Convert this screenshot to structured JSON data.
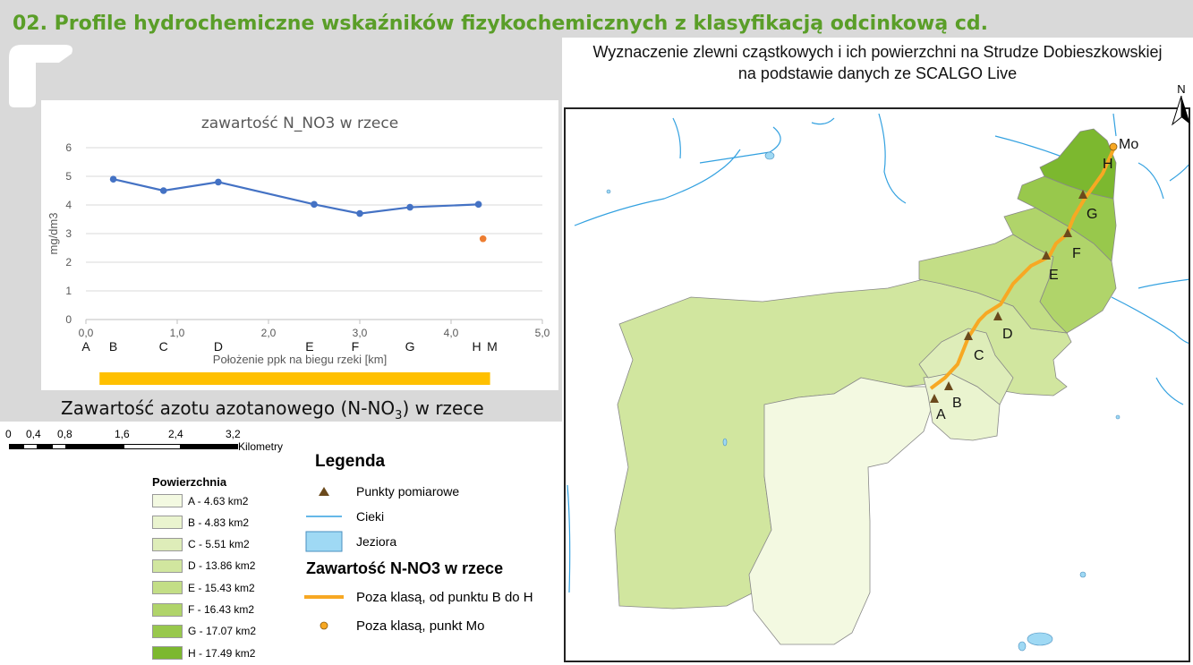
{
  "slide_title": "02.  Profile hydrochemiczne wskaźników fizykochemicznych z klasyfikacją odcinkową cd.",
  "chart_caption": {
    "main": "Zawartość azotu azotanowego (N-NO",
    "sub": "3",
    "tail": ") w rzece"
  },
  "chart_data": {
    "type": "scatter",
    "title": "zawartość N_NO3 w rzece",
    "xlabel": "Położenie ppk na biegu rzeki [km]",
    "ylabel": "mg/dm3",
    "xlim": [
      0,
      5
    ],
    "ylim": [
      0,
      6
    ],
    "x_ticks": [
      "0,0",
      "1,0",
      "2,0",
      "3,0",
      "4,0",
      "5,0"
    ],
    "y_ticks": [
      "0",
      "1",
      "2",
      "3",
      "4",
      "5",
      "6"
    ],
    "grid": true,
    "series": [
      {
        "color": "#4472c4",
        "mode": "line+markers",
        "points": [
          [
            0.3,
            4.9
          ],
          [
            0.85,
            4.5
          ],
          [
            1.45,
            4.8
          ],
          [
            2.5,
            4.02
          ],
          [
            3.0,
            3.7
          ],
          [
            3.55,
            3.92
          ],
          [
            4.3,
            4.02
          ]
        ]
      },
      {
        "color": "#ed7d31",
        "mode": "markers",
        "points": [
          [
            4.35,
            2.82
          ]
        ]
      }
    ],
    "point_labels": [
      {
        "label": "A",
        "x": 0.0
      },
      {
        "label": "B",
        "x": 0.3
      },
      {
        "label": "C",
        "x": 0.85
      },
      {
        "label": "D",
        "x": 1.45
      },
      {
        "label": "E",
        "x": 2.45
      },
      {
        "label": "F",
        "x": 2.95
      },
      {
        "label": "G",
        "x": 3.55
      },
      {
        "label": "H",
        "x": 4.28
      },
      {
        "label": "M",
        "x": 4.45
      }
    ],
    "class_bar": {
      "x_from": 0.1,
      "x_to": 4.3,
      "color": "#ffc000"
    }
  },
  "map": {
    "title_line1": "Wyznaczenie zlewni cząstkowych i ich powierzchni na Strudze Dobieszkowskiej",
    "title_line2": "na podstawie danych ze SCALGO Live",
    "north_label": "N",
    "point_labels": [
      "A",
      "B",
      "C",
      "D",
      "E",
      "F",
      "G",
      "H",
      "Mo"
    ]
  },
  "scale": {
    "labels": [
      "0",
      "0,4",
      "0,8",
      "1,6",
      "2,4",
      "3,2"
    ],
    "unit": "Kilometry"
  },
  "legend": {
    "title": "Legenda",
    "powierzchnia_title": "Powierzchnia",
    "areas": [
      {
        "label": "A - 4.63 km2",
        "color": "#f3f9e1"
      },
      {
        "label": "B - 4.83 km2",
        "color": "#eaf4cf"
      },
      {
        "label": "C - 5.51 km2",
        "color": "#deedb9"
      },
      {
        "label": "D - 13.86 km2",
        "color": "#d1e69f"
      },
      {
        "label": "E - 15.43 km2",
        "color": "#c3de86"
      },
      {
        "label": "F - 16.43 km2",
        "color": "#b0d46a"
      },
      {
        "label": "G - 17.07 km2",
        "color": "#98c84c"
      },
      {
        "label": "H - 17.49 km2",
        "color": "#7cb82f"
      }
    ],
    "points_label": "Punkty pomiarowe",
    "rivers_label": "Cieki",
    "lakes_label": "Jeziora",
    "subtitle": "Zawartość N-NO3 w rzece",
    "class_line_label": "Poza klasą, od punktu B do H",
    "class_point_label": "Poza klasą, punkt Mo"
  }
}
